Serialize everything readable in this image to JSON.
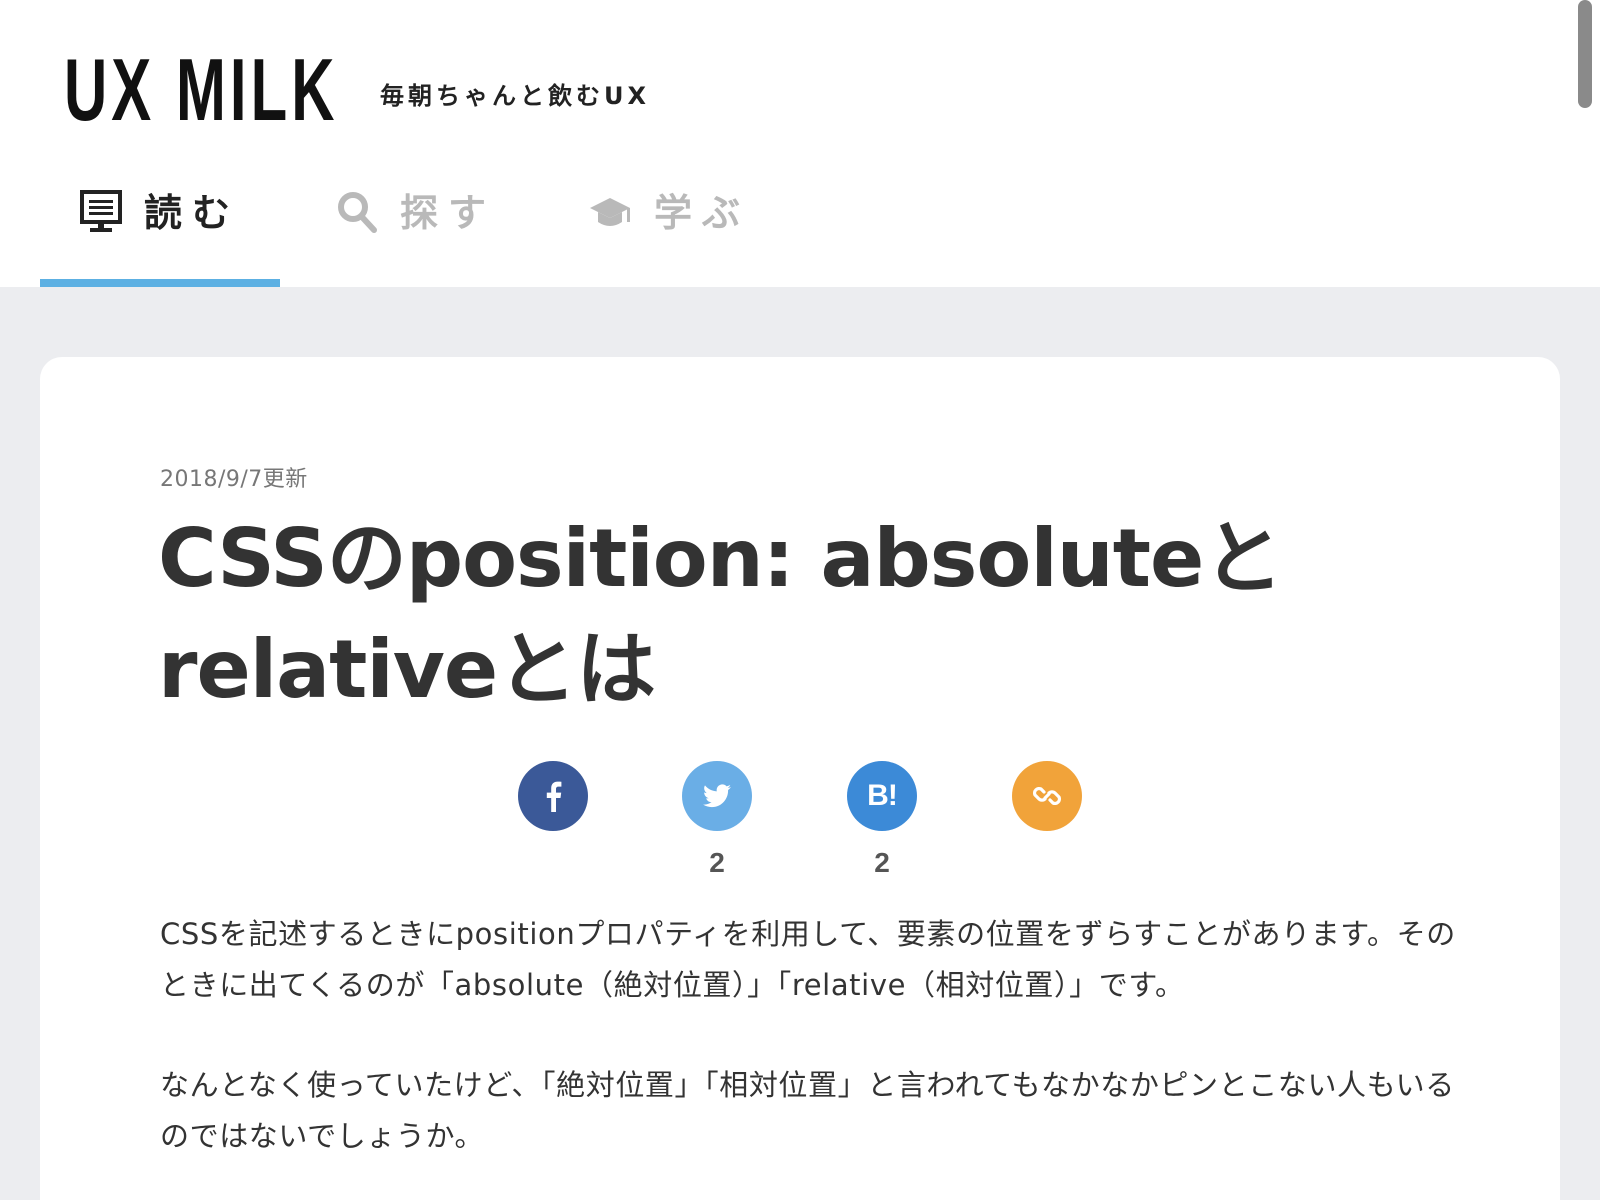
{
  "header": {
    "logo": "UX MILK",
    "tagline": "毎朝ちゃんと飲むUX"
  },
  "nav": {
    "tabs": [
      {
        "label": "読む",
        "icon": "monitor-icon",
        "active": true
      },
      {
        "label": "探す",
        "icon": "search-icon",
        "active": false
      },
      {
        "label": "学ぶ",
        "icon": "graduation-cap-icon",
        "active": false
      }
    ]
  },
  "article": {
    "date": "2018/9/7更新",
    "title_line1": "CSSのposition: absoluteと",
    "title_line2": "relativeとは",
    "paragraphs": [
      "CSSを記述するときにpositionプロパティを利用して、要素の位置をずらすことがあります。そのときに出てくるのが「absolute（絶対位置）」「relative（相対位置）」です。",
      "なんとなく使っていたけど、「絶対位置」「相対位置」と言われてもなかなかピンとこない人もいるのではないでしょうか。"
    ]
  },
  "share": {
    "facebook": {
      "icon": "facebook-icon",
      "count": "",
      "color": "#3b5998"
    },
    "twitter": {
      "icon": "twitter-icon",
      "count": "2",
      "color": "#6aaee6"
    },
    "hatena": {
      "label": "B!",
      "count": "2",
      "color": "#3c8ad7"
    },
    "link": {
      "icon": "link-icon",
      "count": "",
      "color": "#f1a33a"
    }
  },
  "colors": {
    "accent": "#5cb0e3",
    "background": "#ecedf0"
  }
}
